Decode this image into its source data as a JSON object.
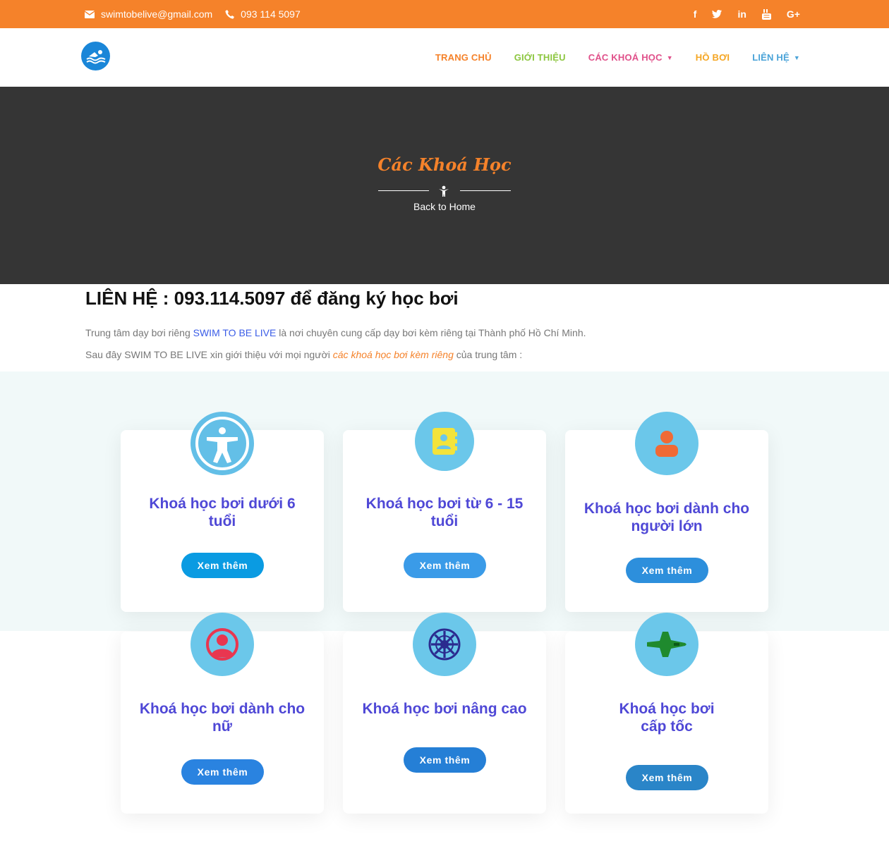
{
  "topbar": {
    "email": "swimtobelive@gmail.com",
    "phone": "093 114 5097",
    "social": [
      "f",
      "twitter",
      "in",
      "youtube",
      "G+"
    ]
  },
  "nav": {
    "items": [
      {
        "label": "TRANG CHỦ",
        "color": "#f5822a",
        "dropdown": false
      },
      {
        "label": "GIỚI THIỆU",
        "color": "#8cc63f",
        "dropdown": false
      },
      {
        "label": "CÁC KHOÁ HỌC",
        "color": "#e0508a",
        "dropdown": true
      },
      {
        "label": "HỒ BƠI",
        "color": "#f5a623",
        "dropdown": false
      },
      {
        "label": "LIÊN HỆ",
        "color": "#4aa3d8",
        "dropdown": true
      }
    ]
  },
  "banner": {
    "title": "Các Khoá Học",
    "back_link": "Back to Home"
  },
  "intro": {
    "heading": "LIÊN HỆ : 093.114.5097 để đăng ký học bơi",
    "p1_before": "Trung tâm dạy bơi riêng ",
    "p1_link": "SWIM TO BE LIVE",
    "p1_after": " là nơi chuyên cung cấp dạy bơi kèm riêng tại Thành phố Hồ Chí Minh.",
    "p2_before": "Sau đây SWIM TO BE LIVE xin giới thiệu với mọi người ",
    "p2_link": "các khoá học bơi kèm riêng",
    "p2_after": " của trung tâm :"
  },
  "courses": [
    {
      "title_line1": "Khoá học bơi dưới 6",
      "title_line2": "tuổi",
      "button": "Xem thêm",
      "icon": "accessibility-icon",
      "button_color": "#0a9be2"
    },
    {
      "title_line1": "Khoá học bơi từ 6 - 15",
      "title_line2": "tuổi",
      "button": "Xem thêm",
      "icon": "contact-book-icon",
      "button_color": "#3a9be8"
    },
    {
      "title_line1": "Khoá học bơi dành cho",
      "title_line2": "người lớn",
      "button": "Xem thêm",
      "icon": "user-icon",
      "button_color": "#2d8fdc"
    },
    {
      "title_line1": "Khoá học bơi dành cho",
      "title_line2": "nữ",
      "button": "Xem thêm",
      "icon": "user-circle-icon",
      "button_color": "#2a83e0"
    },
    {
      "title_line1": "Khoá học bơi nâng cao",
      "title_line2": "",
      "button": "Xem thêm",
      "icon": "galactic-emblem-icon",
      "button_color": "#257fd6"
    },
    {
      "title_line1": "Khoá học bơi",
      "title_line2": "cấp tốc",
      "button": "Xem thêm",
      "icon": "space-shuttle-icon",
      "button_color": "#2a85c8"
    }
  ]
}
